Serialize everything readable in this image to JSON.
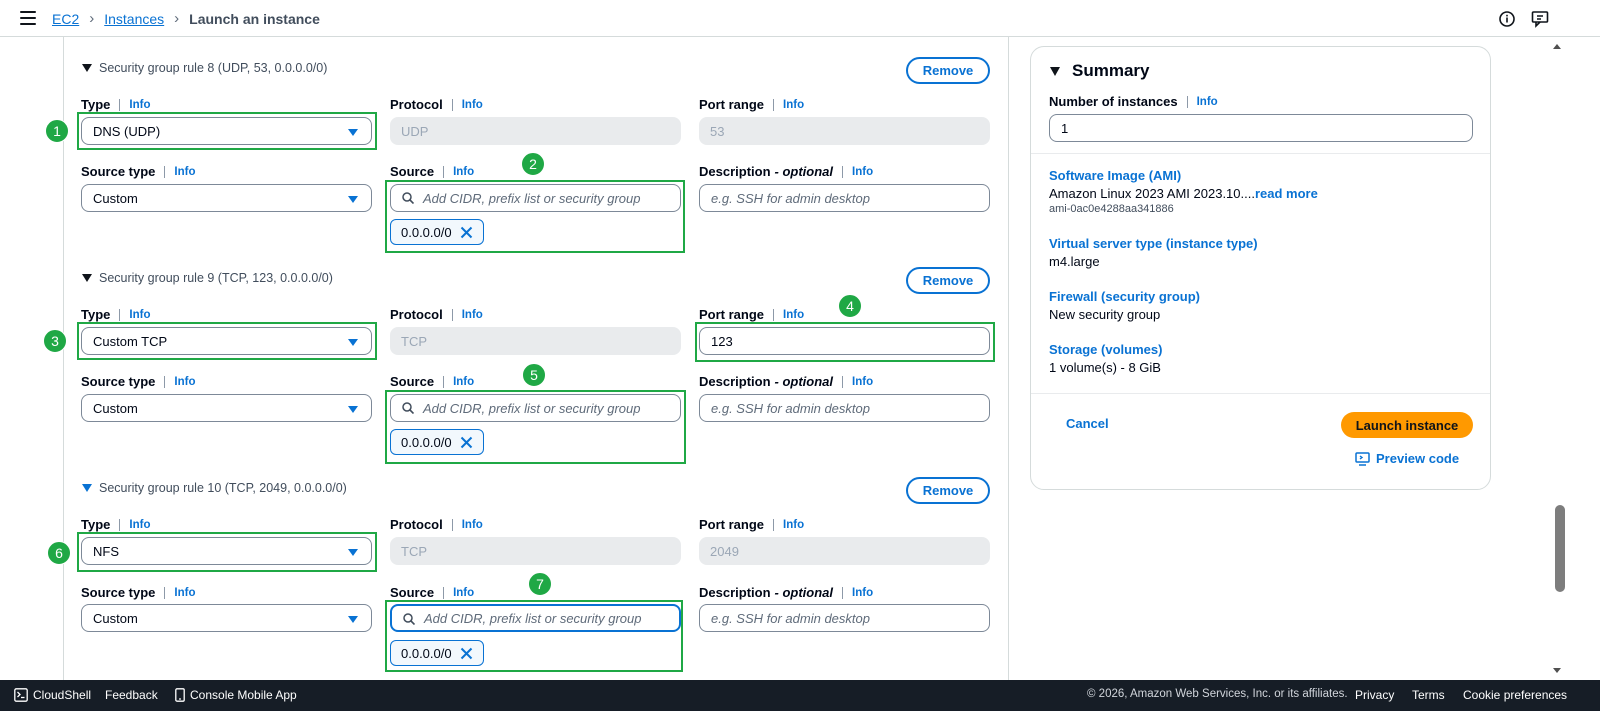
{
  "breadcrumb": {
    "ec2": "EC2",
    "instances": "Instances",
    "current": "Launch an instance"
  },
  "labels": {
    "type": "Type",
    "protocol": "Protocol",
    "port_range": "Port range",
    "source_type": "Source type",
    "source": "Source",
    "description": "Description",
    "optional": "- optional",
    "info": "Info",
    "remove": "Remove"
  },
  "rules": [
    {
      "title": "Security group rule 8 (UDP, 53, 0.0.0.0/0)",
      "type": "DNS (UDP)",
      "protocol": "UDP",
      "port_range": "53",
      "source_type": "Custom",
      "source_placeholder": "Add CIDR, prefix list or security group",
      "token": "0.0.0.0/0",
      "description_placeholder": "e.g. SSH for admin desktop"
    },
    {
      "title": "Security group rule 9 (TCP, 123, 0.0.0.0/0)",
      "type": "Custom TCP",
      "protocol": "TCP",
      "port_range": "123",
      "source_type": "Custom",
      "source_placeholder": "Add CIDR, prefix list or security group",
      "token": "0.0.0.0/0",
      "description_placeholder": "e.g. SSH for admin desktop"
    },
    {
      "title": "Security group rule 10 (TCP, 2049, 0.0.0.0/0)",
      "type": "NFS",
      "protocol": "TCP",
      "port_range": "2049",
      "source_type": "Custom",
      "source_placeholder": "Add CIDR, prefix list or security group",
      "token": "0.0.0.0/0",
      "description_placeholder": "e.g. SSH for admin desktop"
    }
  ],
  "annotations": [
    "1",
    "2",
    "3",
    "4",
    "5",
    "6",
    "7"
  ],
  "summary": {
    "title": "Summary",
    "num_instances_label": "Number of instances",
    "num_instances_value": "1",
    "ami_label": "Software Image (AMI)",
    "ami_value": "Amazon Linux 2023 AMI 2023.10....",
    "ami_read_more": "read more",
    "ami_id": "ami-0ac0e4288aa341886",
    "instance_type_label": "Virtual server type (instance type)",
    "instance_type_value": "m4.large",
    "firewall_label": "Firewall (security group)",
    "firewall_value": "New security group",
    "storage_label": "Storage (volumes)",
    "storage_value": "1 volume(s) - 8 GiB",
    "cancel": "Cancel",
    "launch": "Launch instance",
    "preview": "Preview code"
  },
  "footer": {
    "cloudshell": "CloudShell",
    "feedback": "Feedback",
    "mobile_app": "Console Mobile App",
    "copyright": "© 2026, Amazon Web Services, Inc. or its affiliates.",
    "privacy": "Privacy",
    "terms": "Terms",
    "cookies": "Cookie preferences"
  },
  "colors": {
    "link": "#0972d3",
    "launch": "#ff9900",
    "highlight": "#1fa845",
    "footer_bg": "#161d26"
  }
}
